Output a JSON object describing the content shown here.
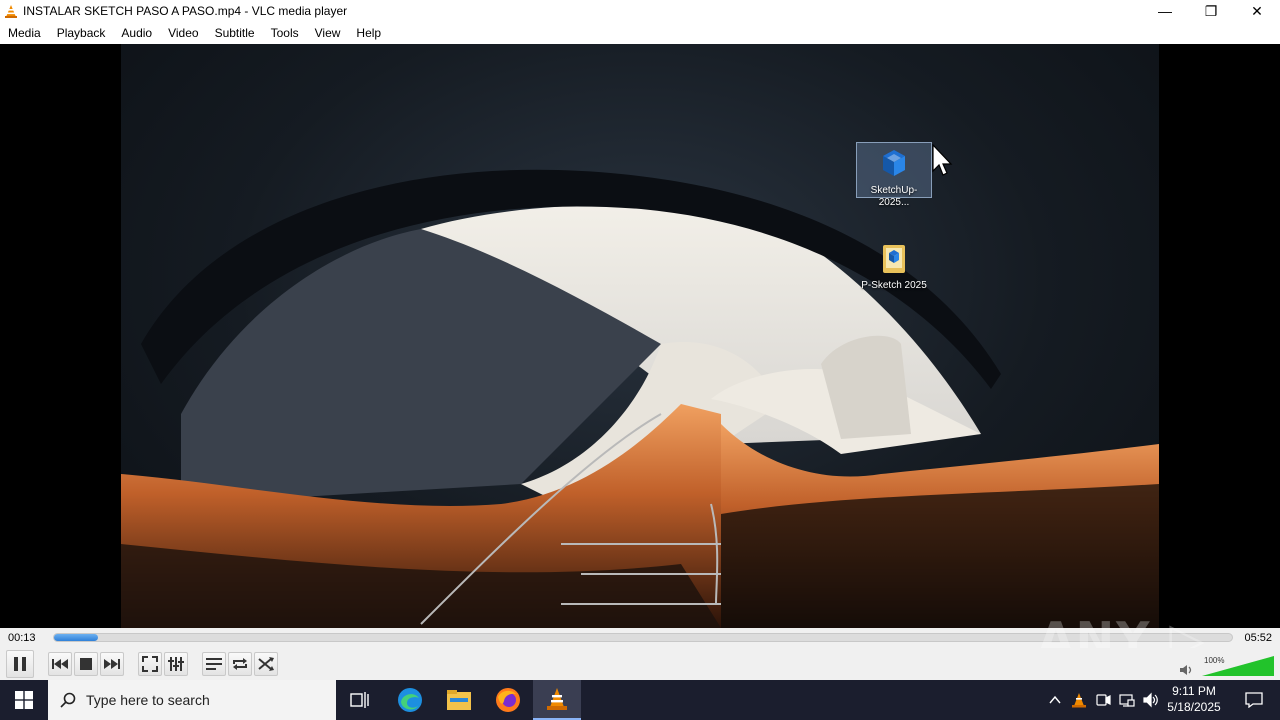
{
  "window": {
    "title": "INSTALAR SKETCH PASO A PASO.mp4 - VLC media player",
    "minimize": "—",
    "maximize": "❐",
    "close": "✕"
  },
  "menu": [
    "Media",
    "Playback",
    "Audio",
    "Video",
    "Subtitle",
    "Tools",
    "View",
    "Help"
  ],
  "desktop_icons": [
    {
      "label": "SketchUp-2025...",
      "icon": "sketchup-installer-icon",
      "selected": true
    },
    {
      "label": "P-Sketch 2025",
      "icon": "folder-icon",
      "selected": false
    }
  ],
  "playback": {
    "elapsed": "00:13",
    "total": "05:52",
    "progress_fraction": 0.037
  },
  "controls": [
    "pause",
    "previous",
    "stop",
    "next",
    "fullscreen",
    "extended-settings",
    "playlist",
    "loop",
    "shuffle"
  ],
  "volume": {
    "percent_label": "100%",
    "level_fraction": 1.0
  },
  "watermark": "ANY ▷ RUN",
  "taskbar": {
    "search_placeholder": "Type here to search",
    "apps": [
      "task-view",
      "edge",
      "file-explorer",
      "firefox",
      "vlc"
    ],
    "clock_time": "9:11 PM",
    "clock_date": "5/18/2025"
  },
  "colors": {
    "accent": "#2f80d8",
    "taskbar": "#1b1e2e",
    "vlc_orange": "#f08a00",
    "volume_green": "#22c32b"
  }
}
